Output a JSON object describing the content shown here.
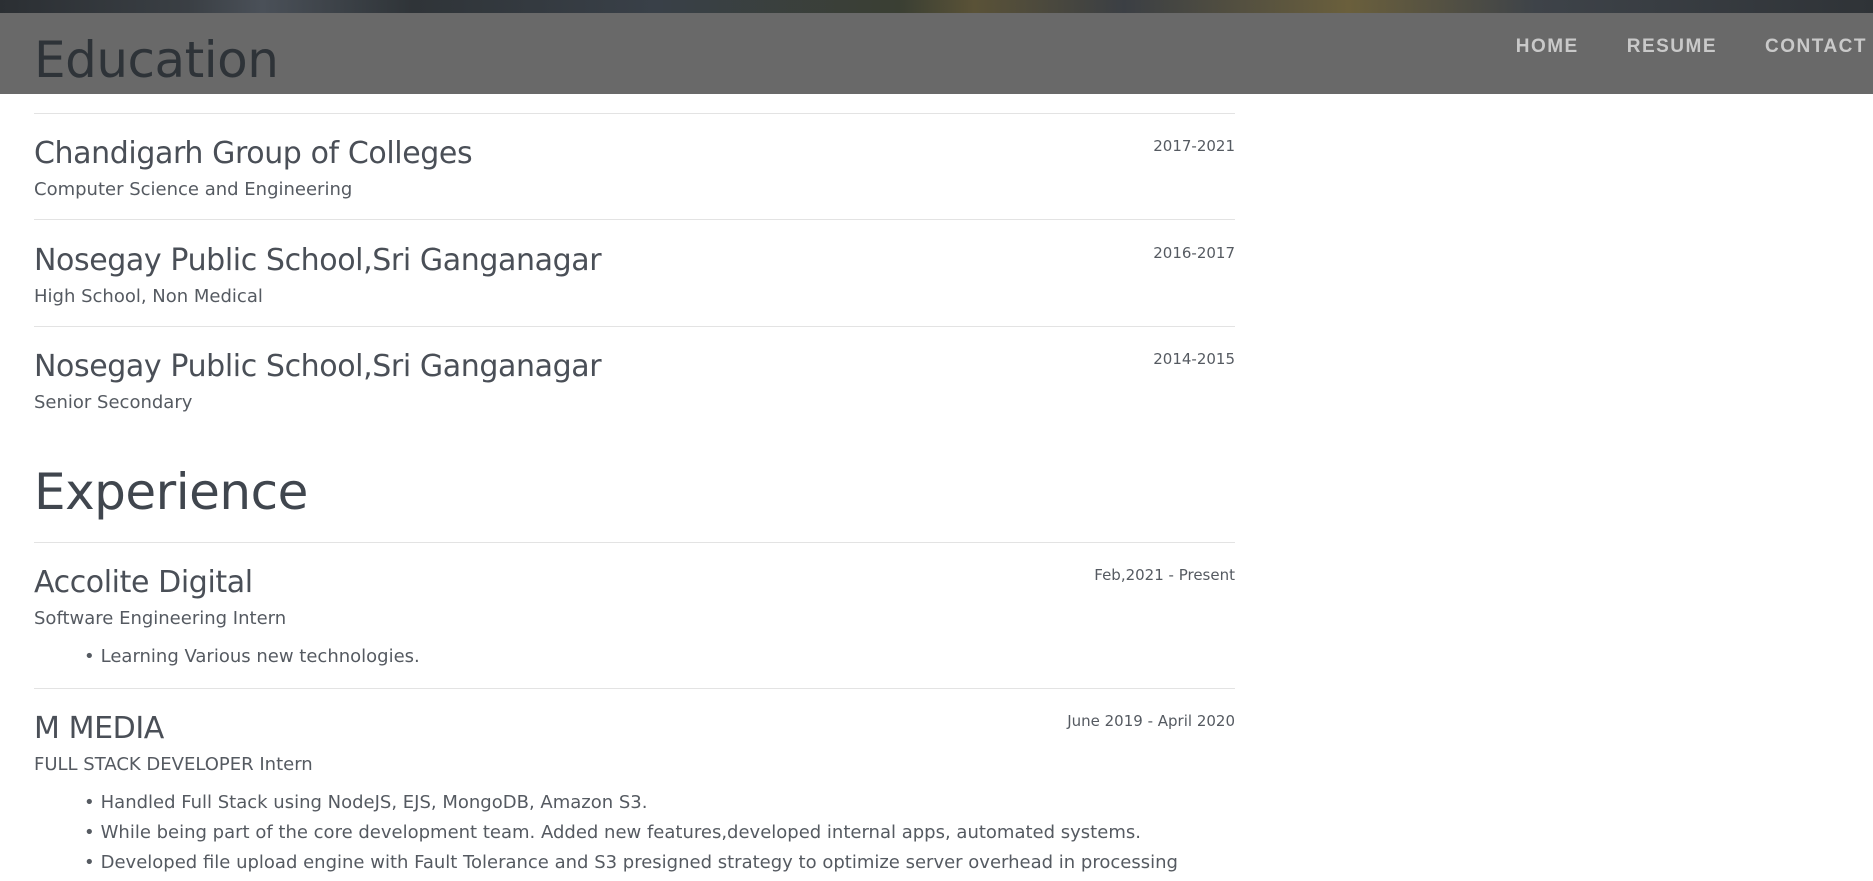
{
  "nav": {
    "home": "HOME",
    "resume": "RESUME",
    "contact": "CONTACT"
  },
  "education": {
    "title": "Education",
    "items": [
      {
        "name": "Chandigarh Group of Colleges",
        "sub": "Computer Science and Engineering",
        "date": "2017-2021"
      },
      {
        "name": "Nosegay Public School,Sri Ganganagar",
        "sub": "High School, Non Medical",
        "date": "2016-2017"
      },
      {
        "name": "Nosegay Public School,Sri Ganganagar",
        "sub": "Senior Secondary",
        "date": "2014-2015"
      }
    ]
  },
  "experience": {
    "title": "Experience",
    "items": [
      {
        "name": "Accolite Digital",
        "sub": "Software Engineering Intern",
        "date": "Feb,2021 - Present",
        "bullets": [
          "Learning Various new technologies."
        ]
      },
      {
        "name": "M MEDIA",
        "sub": "FULL STACK DEVELOPER Intern",
        "date": "June 2019 - April 2020",
        "bullets": [
          "Handled Full Stack using NodeJS, EJS, MongoDB, Amazon S3.",
          "While being part of the core development team. Added new features,developed internal apps, automated systems.",
          "Developed file upload engine with Fault Tolerance and S3 presigned strategy to optimize server overhead in processing upload."
        ]
      }
    ]
  }
}
